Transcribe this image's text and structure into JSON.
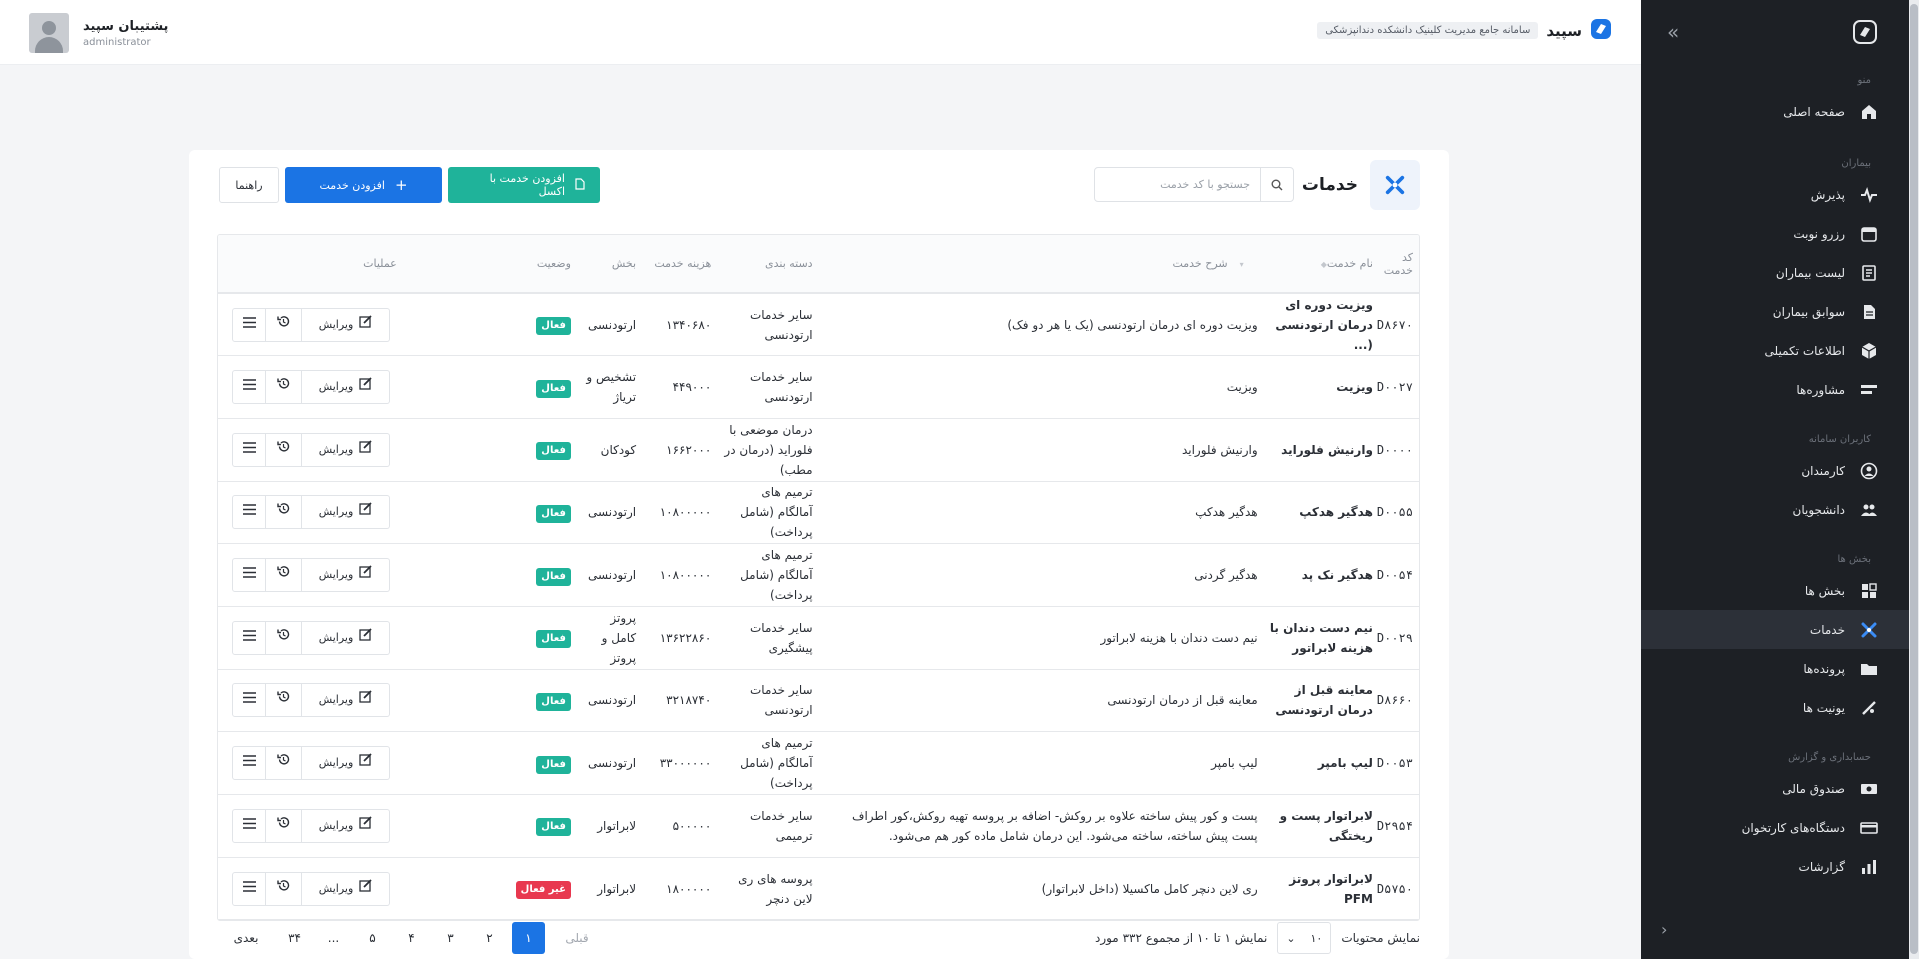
{
  "header": {
    "brand_name": "سپید",
    "brand_subtitle": "سامانه جامع مدیریت کلینیک دانشکده دندانپزشکی",
    "user_name": "پشتیبان سپید",
    "user_role": "administrator"
  },
  "sidebar": {
    "sections": {
      "menu": "منو",
      "patients": "بیماران",
      "users": "کاربران سامانه",
      "departments": "بخش ها",
      "accounting": "حسابداری و گزارش"
    },
    "items": [
      {
        "label": "صفحه اصلی",
        "icon": "home-icon"
      },
      {
        "label": "پذیرش",
        "icon": "heartbeat-icon"
      },
      {
        "label": "رزرو نوبت",
        "icon": "calendar-icon"
      },
      {
        "label": "لیست بیماران",
        "icon": "patient-list-icon"
      },
      {
        "label": "سوابق بیماران",
        "icon": "document-icon"
      },
      {
        "label": "اطلاعات تکمیلی",
        "icon": "cube-icon"
      },
      {
        "label": "مشاوره‌ها",
        "icon": "consult-icon"
      },
      {
        "label": "کارمندان",
        "icon": "user-circle-icon"
      },
      {
        "label": "دانشجویان",
        "icon": "students-icon"
      },
      {
        "label": "بخش ها",
        "icon": "grid-icon"
      },
      {
        "label": "خدمات",
        "icon": "services-icon"
      },
      {
        "label": "پرونده‌ها",
        "icon": "folder-icon"
      },
      {
        "label": "یونیت ها",
        "icon": "dental-unit-icon"
      },
      {
        "label": "صندوق مالی",
        "icon": "cash-icon"
      },
      {
        "label": "دستگاه‌های کارتخوان",
        "icon": "card-reader-icon"
      },
      {
        "label": "گزارشات",
        "icon": "report-icon"
      }
    ]
  },
  "page": {
    "title": "خدمات",
    "search_placeholder": "جستجو با کد خدمت",
    "help_button": "راهنما",
    "add_button": "افزودن خدمت",
    "excel_button": "افزودن خدمت با اکسل"
  },
  "table": {
    "columns": [
      "کد خدمت",
      "نام خدمت",
      "شرح خدمت",
      "دسته بندی",
      "هزینه خدمت",
      "بخش",
      "وضعیت",
      "عملیات"
    ],
    "edit_label": "ویرایش",
    "rows": [
      {
        "code": "D۸۶۷۰",
        "name": "ویزیت دوره ای درمان ارتودنسی (...",
        "desc": "ویزیت دوره ای درمان ارتودنسی (یک یا هر دو فک)",
        "category": "سایر خدمات ارتودنسی",
        "cost": "۱۳۴۰۶۸۰",
        "dept": "ارتودنسی",
        "status": "فعال",
        "active": true
      },
      {
        "code": "D۰۰۲۷",
        "name": "ویزیت",
        "desc": "ویزیت",
        "category": "سایر خدمات ارتودنسی",
        "cost": "۴۴۹۰۰۰",
        "dept": "تشخیص و تریاژ",
        "status": "فعال",
        "active": true
      },
      {
        "code": "D۰۰۰۰",
        "name": "وارنیش فلوراید",
        "desc": "وارنیش فلوراید",
        "category": "درمان موضعی با فلوراید (درمان در مطب)",
        "cost": "۱۶۶۲۰۰۰",
        "dept": "کودکان",
        "status": "فعال",
        "active": true
      },
      {
        "code": "D۰۰۵۵",
        "name": "هدگیر هدکپ",
        "desc": "هدگیر هدکپ",
        "category": "ترمیم های آمالگام (شامل پرداخت)",
        "cost": "۱۰۸۰۰۰۰۰",
        "dept": "ارتودنسی",
        "status": "فعال",
        "active": true
      },
      {
        "code": "D۰۰۵۴",
        "name": "هدگیر نک پد",
        "desc": "هدگیر گردنی",
        "category": "ترمیم های آمالگام (شامل پرداخت)",
        "cost": "۱۰۸۰۰۰۰۰",
        "dept": "ارتودنسی",
        "status": "فعال",
        "active": true
      },
      {
        "code": "D۰۰۲۹",
        "name": "نیم دست دندان با هزینه لابراتور",
        "desc": "نیم دست دندان با هزینه لابراتور",
        "category": "سایر خدمات پیشگیری",
        "cost": "۱۳۶۲۲۸۶۰",
        "dept": "پروتز کامل و پروتز",
        "status": "فعال",
        "active": true
      },
      {
        "code": "D۸۶۶۰",
        "name": "معاینه قبل از درمان ارتودنسی",
        "desc": "معاینه قبل از درمان ارتودنسی",
        "category": "سایر خدمات ارتودنسی",
        "cost": "۳۲۱۸۷۴۰",
        "dept": "ارتودنسی",
        "status": "فعال",
        "active": true
      },
      {
        "code": "D۰۰۵۳",
        "name": "لیپ بامپر",
        "desc": "لیپ بامپر",
        "category": "ترمیم های آمالگام (شامل پرداخت)",
        "cost": "۳۳۰۰۰۰۰۰",
        "dept": "ارتودنسی",
        "status": "فعال",
        "active": true
      },
      {
        "code": "D۲۹۵۴",
        "name": "لابراتوار پست و ریختگی",
        "desc": "پست و کور پیش ساخته علاوه بر روکش- اضافه بر پروسه تهیه روکش،کور اطراف پست پیش ساخته، ساخته می‌شود. این درمان شامل ماده کور هم می‌شود.",
        "category": "سایر خدمات ترمیمی",
        "cost": "۵۰۰۰۰۰",
        "dept": "لابراتوار",
        "status": "فعال",
        "active": true
      },
      {
        "code": "D۵۷۵۰",
        "name": "لابراتوار پروتز PFM",
        "desc": "ری لاین دنچر کامل ماکسیلا (داخل لابراتوار)",
        "category": "پروسه های ری لاین دنچر",
        "cost": "۱۸۰۰۰۰۰",
        "dept": "لابراتوار",
        "status": "غیر فعال",
        "active": false
      }
    ]
  },
  "pagination": {
    "show_label": "نمایش محتویات",
    "page_size": "۱۰",
    "summary": "نمایش ۱ تا ۱۰ از مجموع ۳۳۲ مورد",
    "prev": "قبلی",
    "next": "بعدی",
    "pages": [
      "۱",
      "۲",
      "۳",
      "۴",
      "۵",
      "...",
      "۳۴"
    ],
    "current": "۱"
  },
  "colors": {
    "primary": "#1b74e4",
    "success": "#1fb39a",
    "danger": "#e8384f",
    "sidebar_bg": "#1d2025"
  }
}
